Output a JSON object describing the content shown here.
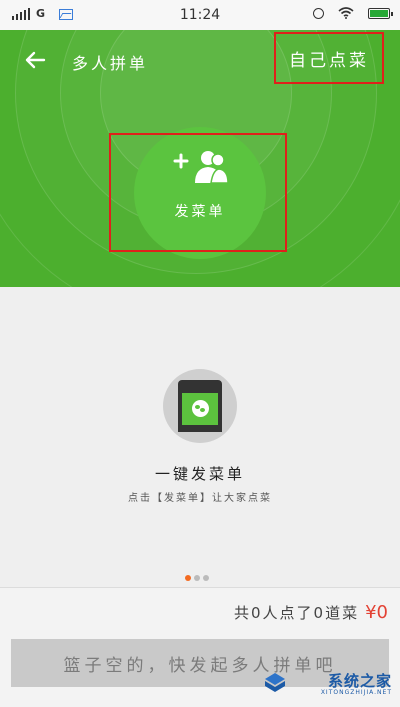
{
  "status_bar": {
    "network": "G",
    "time": "11:24"
  },
  "header": {
    "title": "多人拼单",
    "self_order_label": "自己点菜"
  },
  "hero": {
    "send_label": "发菜单"
  },
  "promo": {
    "headline": "一键发菜单",
    "subline": "点击【发菜单】让大家点菜"
  },
  "summary": {
    "text": "共0人点了0道菜",
    "price": "¥0"
  },
  "empty_button_label": "篮子空的，快发起多人拼单吧",
  "watermark": {
    "text": "系统之家",
    "sub": "XITONGZHIJIA.NET"
  },
  "colors": {
    "brand_green": "#4caf2e",
    "highlight_red": "#e0201b",
    "price_red": "#e34234",
    "dot_active": "#f36b21"
  },
  "icons": {
    "back": "arrow-left-icon",
    "add_group": "add-group-icon",
    "wechat": "wechat-icon"
  },
  "pager": {
    "count": 3,
    "active": 1
  }
}
